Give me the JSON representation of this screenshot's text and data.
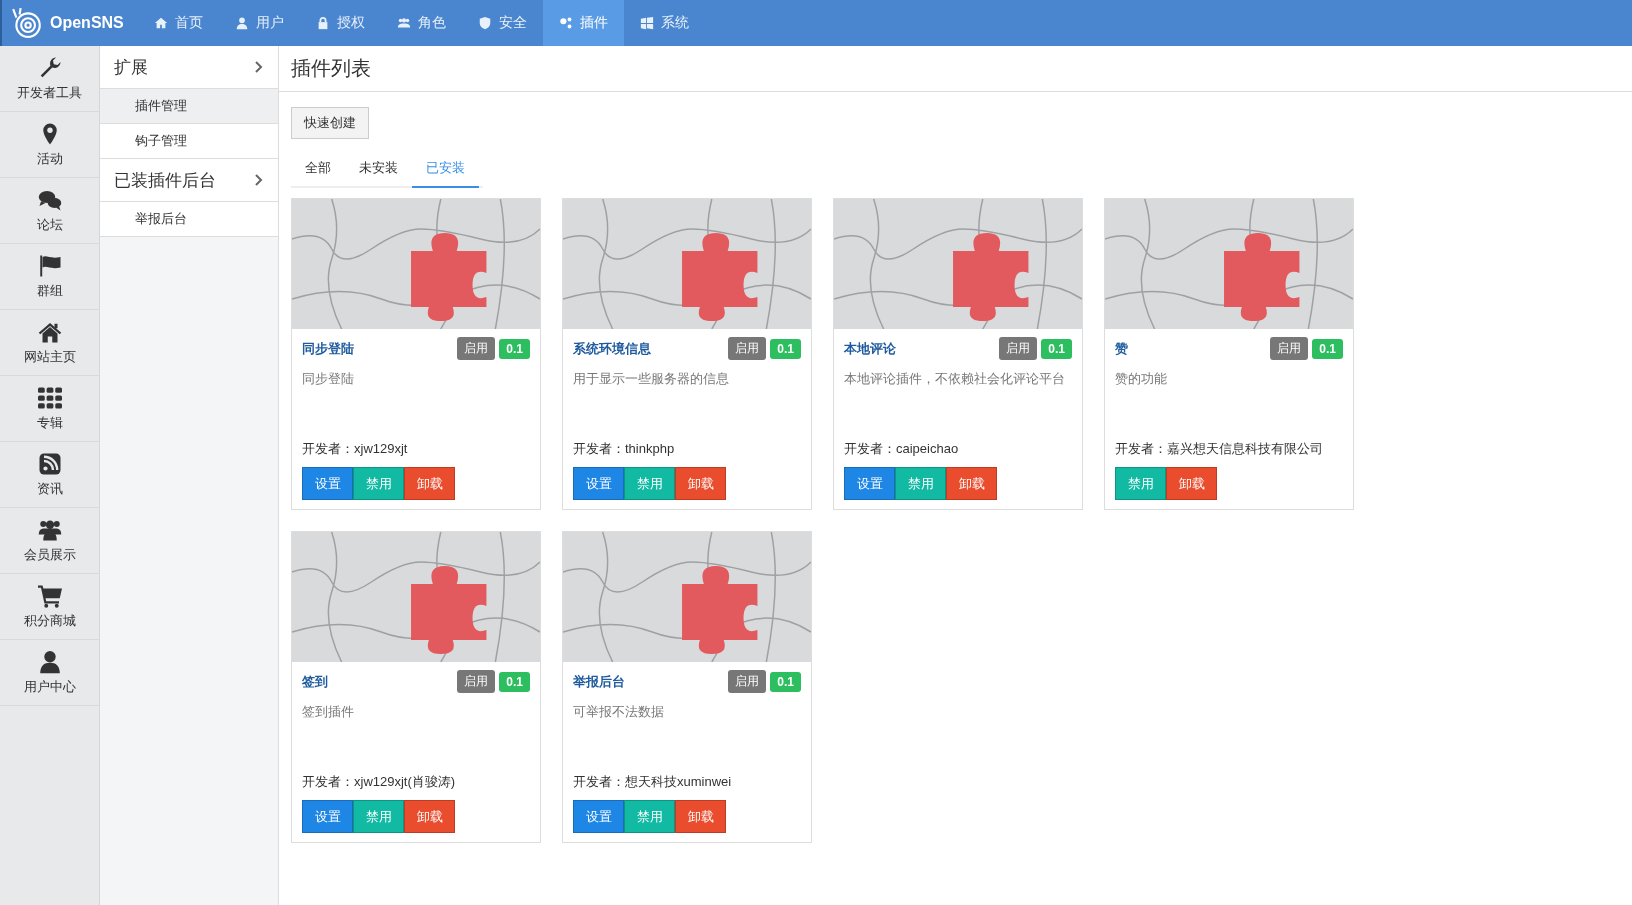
{
  "brand": "OpenSNS",
  "nav": [
    {
      "label": "首页",
      "selected": false
    },
    {
      "label": "用户",
      "selected": false
    },
    {
      "label": "授权",
      "selected": false
    },
    {
      "label": "角色",
      "selected": false
    },
    {
      "label": "安全",
      "selected": false
    },
    {
      "label": "插件",
      "selected": true
    },
    {
      "label": "系统",
      "selected": false
    }
  ],
  "modules": [
    "开发者工具",
    "活动",
    "论坛",
    "群组",
    "网站主页",
    "专辑",
    "资讯",
    "会员展示",
    "积分商城",
    "用户中心"
  ],
  "menu": [
    {
      "title": "扩展",
      "children": [
        {
          "label": "插件管理",
          "selected": true
        },
        {
          "label": "钩子管理",
          "selected": false
        }
      ]
    },
    {
      "title": "已装插件后台",
      "children": [
        {
          "label": "举报后台",
          "selected": false
        }
      ]
    }
  ],
  "page_title": "插件列表",
  "create_button": "快速创建",
  "tabs": [
    {
      "label": "全部",
      "selected": false
    },
    {
      "label": "未安装",
      "selected": false
    },
    {
      "label": "已安装",
      "selected": true
    }
  ],
  "plugins": [
    {
      "title": "同步登陆",
      "status": "启用",
      "version": "0.1",
      "description": "同步登陆",
      "developer": "开发者：xjw129xjt",
      "buttons": [
        {
          "kind": "settings",
          "label": "设置"
        },
        {
          "kind": "disable",
          "label": "禁用"
        },
        {
          "kind": "uninstall",
          "label": "卸载"
        }
      ]
    },
    {
      "title": "系统环境信息",
      "status": "启用",
      "version": "0.1",
      "description": "用于显示一些服务器的信息",
      "developer": "开发者：thinkphp",
      "buttons": [
        {
          "kind": "settings",
          "label": "设置"
        },
        {
          "kind": "disable",
          "label": "禁用"
        },
        {
          "kind": "uninstall",
          "label": "卸载"
        }
      ]
    },
    {
      "title": "本地评论",
      "status": "启用",
      "version": "0.1",
      "description": "本地评论插件，不依赖社会化评论平台",
      "developer": "开发者：caipeichao",
      "buttons": [
        {
          "kind": "settings",
          "label": "设置"
        },
        {
          "kind": "disable",
          "label": "禁用"
        },
        {
          "kind": "uninstall",
          "label": "卸载"
        }
      ]
    },
    {
      "title": "赞",
      "status": "启用",
      "version": "0.1",
      "description": "赞的功能",
      "developer": "开发者：嘉兴想天信息科技有限公司",
      "buttons": [
        {
          "kind": "disable",
          "label": "禁用"
        },
        {
          "kind": "uninstall",
          "label": "卸载"
        }
      ]
    },
    {
      "title": "签到",
      "status": "启用",
      "version": "0.1",
      "description": "签到插件",
      "developer": "开发者：xjw129xjt(肖骏涛)",
      "buttons": [
        {
          "kind": "settings",
          "label": "设置"
        },
        {
          "kind": "disable",
          "label": "禁用"
        },
        {
          "kind": "uninstall",
          "label": "卸载"
        }
      ]
    },
    {
      "title": "举报后台",
      "status": "启用",
      "version": "0.1",
      "description": "可举报不法数据",
      "developer": "开发者：想天科技xuminwei",
      "buttons": [
        {
          "kind": "settings",
          "label": "设置"
        },
        {
          "kind": "disable",
          "label": "禁用"
        },
        {
          "kind": "uninstall",
          "label": "卸载"
        }
      ]
    }
  ]
}
